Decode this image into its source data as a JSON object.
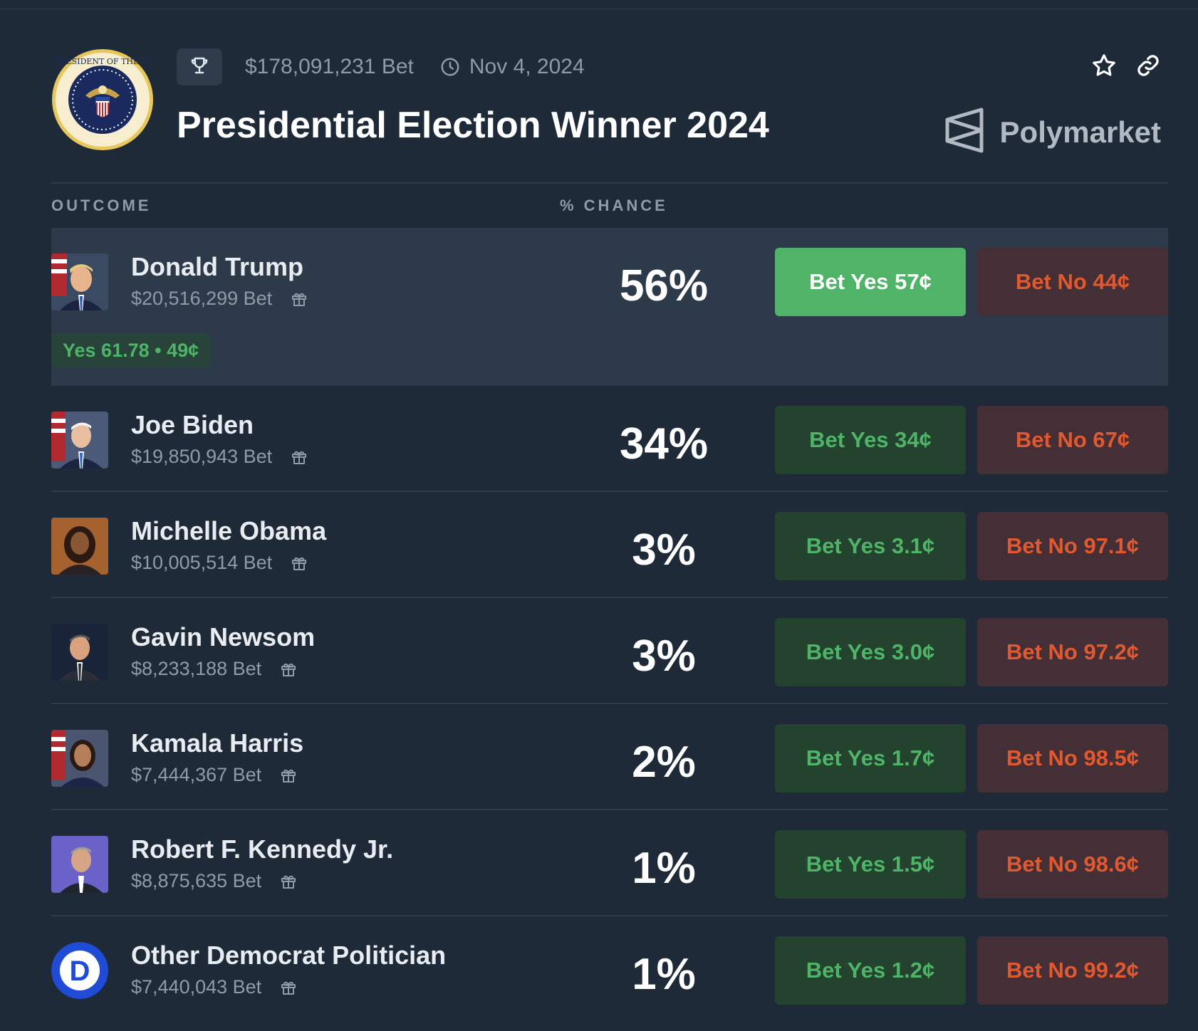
{
  "header": {
    "volume": "$178,091,231 Bet",
    "date": "Nov 4, 2024",
    "title": "Presidential Election Winner 2024",
    "brand": "Polymarket"
  },
  "columns": {
    "outcome": "OUTCOME",
    "chance": "% CHANCE"
  },
  "outcomes": [
    {
      "name": "Donald Trump",
      "bet": "$20,516,299 Bet",
      "chance": "56%",
      "yes": "Bet Yes 57¢",
      "no": "Bet No 44¢",
      "position": "Yes 61.78 • 49¢"
    },
    {
      "name": "Joe Biden",
      "bet": "$19,850,943 Bet",
      "chance": "34%",
      "yes": "Bet Yes 34¢",
      "no": "Bet No 67¢"
    },
    {
      "name": "Michelle Obama",
      "bet": "$10,005,514 Bet",
      "chance": "3%",
      "yes": "Bet Yes 3.1¢",
      "no": "Bet No 97.1¢"
    },
    {
      "name": "Gavin Newsom",
      "bet": "$8,233,188 Bet",
      "chance": "3%",
      "yes": "Bet Yes 3.0¢",
      "no": "Bet No 97.2¢"
    },
    {
      "name": "Kamala Harris",
      "bet": "$7,444,367 Bet",
      "chance": "2%",
      "yes": "Bet Yes 1.7¢",
      "no": "Bet No 98.5¢"
    },
    {
      "name": "Robert F. Kennedy Jr.",
      "bet": "$8,875,635 Bet",
      "chance": "1%",
      "yes": "Bet Yes 1.5¢",
      "no": "Bet No 98.6¢"
    },
    {
      "name": "Other Democrat Politician",
      "bet": "$7,440,043 Bet",
      "chance": "1%",
      "yes": "Bet Yes 1.2¢",
      "no": "Bet No 99.2¢"
    }
  ],
  "seal_text": "SEAL OF THE PRESIDENT OF THE UNITED STATES",
  "party_logo_letter": "D",
  "colors": {
    "background": "#1e2a37",
    "yes_green": "#4fb368",
    "no_red": "#e2582f",
    "muted_text": "#8f9ba8"
  },
  "icons": [
    "trophy-icon",
    "clock-icon",
    "star-icon",
    "link-icon",
    "polymarket-logo-icon",
    "gift-icon"
  ]
}
